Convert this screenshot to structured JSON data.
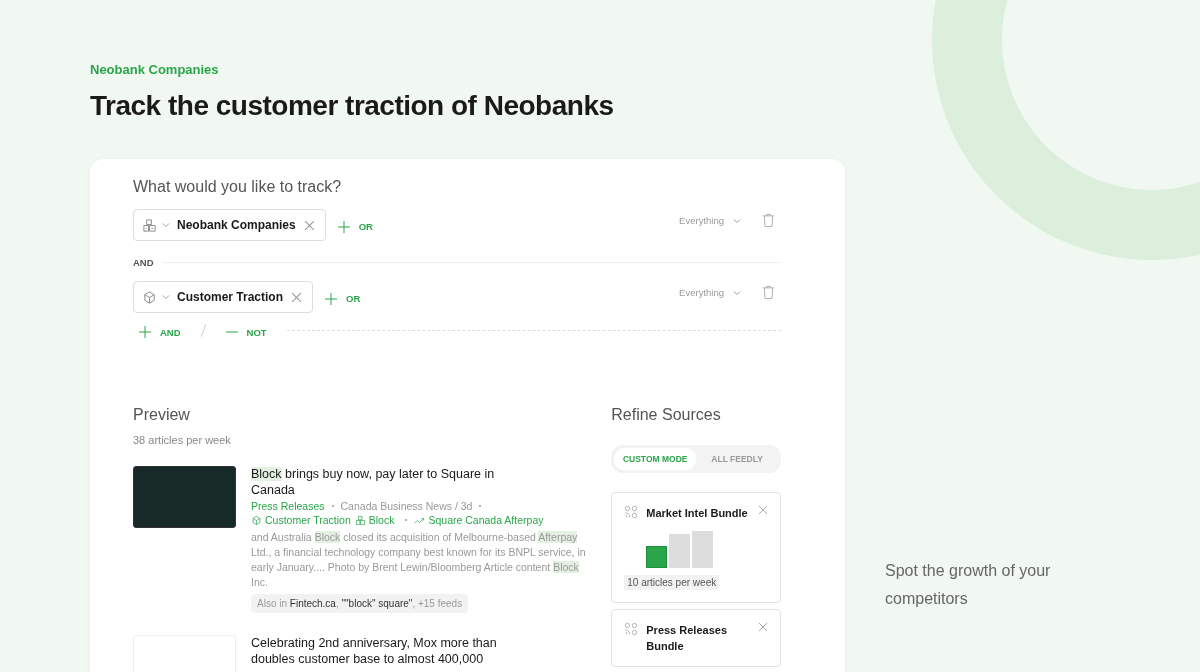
{
  "eyebrow": "Neobank Companies",
  "headline": "Track the customer traction of Neobanks",
  "tracker": {
    "question": "What would you like to track?",
    "rules": [
      {
        "kind": "building",
        "label": "Neobank Companies",
        "or": "OR",
        "scope": "Everything"
      },
      {
        "kind": "cube",
        "label": "Customer Traction",
        "or": "OR",
        "scope": "Everything"
      }
    ],
    "joiner": "AND",
    "add_and": "AND",
    "add_not": "NOT"
  },
  "preview": {
    "title": "Preview",
    "count": "38 articles per week",
    "articles": [
      {
        "has_image": true,
        "title": [
          {
            "text": "Block",
            "highlight": true
          },
          {
            "text": " brings buy now, pay later to Square in Canada",
            "highlight": false
          }
        ],
        "source": "Press Releases",
        "feed": "Canada Business News / 3d",
        "tags": [
          {
            "kind": "cube",
            "label": "Customer Traction"
          },
          {
            "kind": "building",
            "label": "Block"
          },
          {
            "kind": "trend",
            "label": "Square Canada Afterpay"
          }
        ],
        "snippet": [
          {
            "text": "and Australia ",
            "highlight": false
          },
          {
            "text": "Block",
            "highlight": true
          },
          {
            "text": " closed its acquisition of Melbourne-based ",
            "highlight": false
          },
          {
            "text": "Afterpay",
            "highlight": true
          },
          {
            "text": " Ltd., a financial technology company best known for its BNPL service, in early January.... Photo by Brent Lewin/Bloomberg Article content ",
            "highlight": false
          },
          {
            "text": "Block",
            "highlight": true
          },
          {
            "text": " Inc.",
            "highlight": false
          }
        ],
        "also": [
          {
            "text": "Also in ",
            "highlight": false
          },
          {
            "text": "Fintech.ca",
            "highlight": true
          },
          {
            "text": ", ",
            "highlight": false
          },
          {
            "text": "\"\"block\" square\"",
            "highlight": true
          },
          {
            "text": ", +15 feeds",
            "highlight": false
          }
        ]
      },
      {
        "has_image": false,
        "title": [
          {
            "text": "Celebrating 2nd anniversary, Mox more than doubles customer base to almost 400,000",
            "highlight": false
          }
        ]
      }
    ]
  },
  "sources": {
    "title": "Refine Sources",
    "modes": [
      {
        "label": "CUSTOM MODE",
        "selected": true
      },
      {
        "label": "ALL FEEDLY",
        "selected": false
      }
    ],
    "bundles": [
      {
        "name": "Market Intel Bundle",
        "bars": [
          {
            "selected": true
          },
          {
            "selected": false
          },
          {
            "selected": false
          }
        ],
        "volume": "10 articles per week"
      },
      {
        "name": "Press Releases Bundle"
      }
    ]
  },
  "tagline": "Spot the growth of your competitors"
}
